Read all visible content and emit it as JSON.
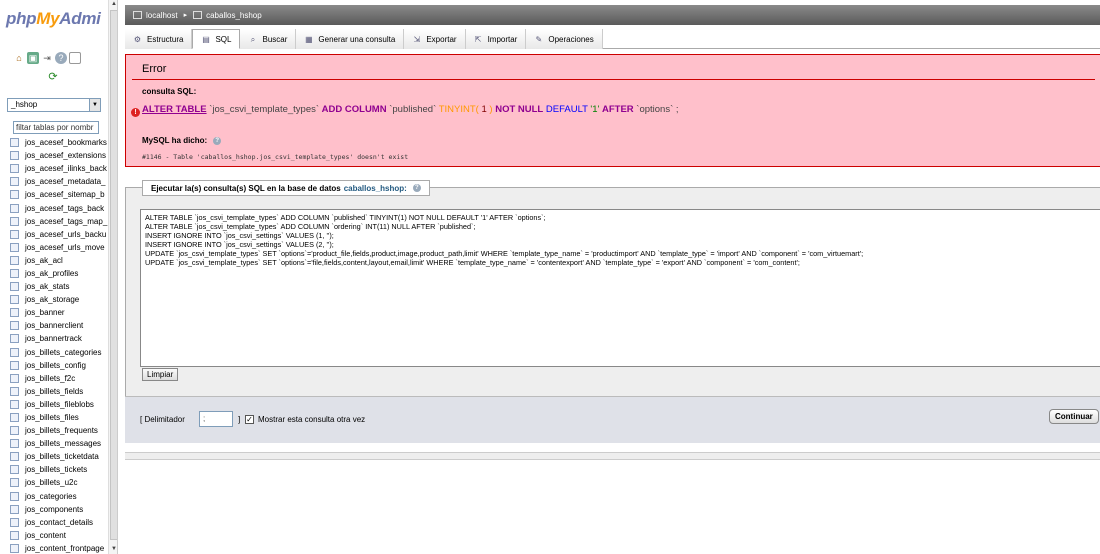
{
  "left": {
    "logo_php": "php",
    "logo_my": "My",
    "logo_admin": "Admi",
    "db_select": "_hshop",
    "filter_placeholder": "filtar tablas por nombr",
    "tables": [
      "jos_acesef_bookmarks",
      "jos_acesef_extensions",
      "jos_acesef_ilinks_back",
      "jos_acesef_metadata_",
      "jos_acesef_sitemap_b",
      "jos_acesef_tags_back",
      "jos_acesef_tags_map_",
      "jos_acesef_urls_backu",
      "jos_acesef_urls_move",
      "jos_ak_acl",
      "jos_ak_profiles",
      "jos_ak_stats",
      "jos_ak_storage",
      "jos_banner",
      "jos_bannerclient",
      "jos_bannertrack",
      "jos_billets_categories",
      "jos_billets_config",
      "jos_billets_f2c",
      "jos_billets_fields",
      "jos_billets_fileblobs",
      "jos_billets_files",
      "jos_billets_frequents",
      "jos_billets_messages",
      "jos_billets_ticketdata",
      "jos_billets_tickets",
      "jos_billets_u2c",
      "jos_categories",
      "jos_components",
      "jos_contact_details",
      "jos_content",
      "jos_content_frontpage"
    ]
  },
  "breadcrumb": {
    "server": "localhost",
    "database": "caballos_hshop"
  },
  "tabs": [
    {
      "label": "Estructura",
      "icon": "structure-icon"
    },
    {
      "label": "SQL",
      "icon": "sql-icon"
    },
    {
      "label": "Buscar",
      "icon": "search-icon"
    },
    {
      "label": "Generar una consulta",
      "icon": "query-icon"
    },
    {
      "label": "Exportar",
      "icon": "export-icon"
    },
    {
      "label": "Importar",
      "icon": "import-icon"
    },
    {
      "label": "Operaciones",
      "icon": "operations-icon"
    }
  ],
  "error": {
    "title": "Error",
    "consulta_label": "consulta SQL:",
    "sql_parts": [
      "ALTER TABLE",
      " `jos_csvi_template_types` ",
      "ADD COLUMN",
      " `published` ",
      "TINYINT",
      "( ",
      "1",
      " ) ",
      "NOT NULL",
      " ",
      "DEFAULT",
      " ",
      "'1'",
      " ",
      "AFTER",
      " `options` ;"
    ],
    "mysql_said": "MySQL ha dicho:",
    "message": "#1146 - Table 'caballos_hshop.jos_csvi_template_types' doesn't exist"
  },
  "sql_panel": {
    "legend": "Ejecutar la(s) consulta(s) SQL en la base de datos",
    "legend_db": "caballos_hshop:",
    "query": "ALTER TABLE `jos_csvi_template_types` ADD COLUMN `published` TINYINT(1) NOT NULL DEFAULT '1' AFTER `options`;\nALTER TABLE `jos_csvi_template_types` ADD COLUMN `ordering` INT(11) NULL AFTER `published`;\nINSERT IGNORE INTO `jos_csvi_settings` VALUES (1, '');\nINSERT IGNORE INTO `jos_csvi_settings` VALUES (2, '');\nUPDATE `jos_csvi_template_types` SET `options`='product_file,fields,product,image,product_path,limit' WHERE `template_type_name` = 'productimport' AND `template_type` = 'import' AND `component` = 'com_virtuemart';\nUPDATE `jos_csvi_template_types` SET `options`='file,fields,content,layout,email,limit' WHERE `template_type_name` = 'contentexport' AND `template_type` = 'export' AND `component` = 'com_content';",
    "clear_label": "Limpiar",
    "delimiter_label": "[ Delimitador",
    "delimiter_value": ";",
    "delimiter_close": "]",
    "show_again_label": "Mostrar esta consulta otra vez",
    "show_again_checked": "✓",
    "continue_label": "Continuar"
  }
}
